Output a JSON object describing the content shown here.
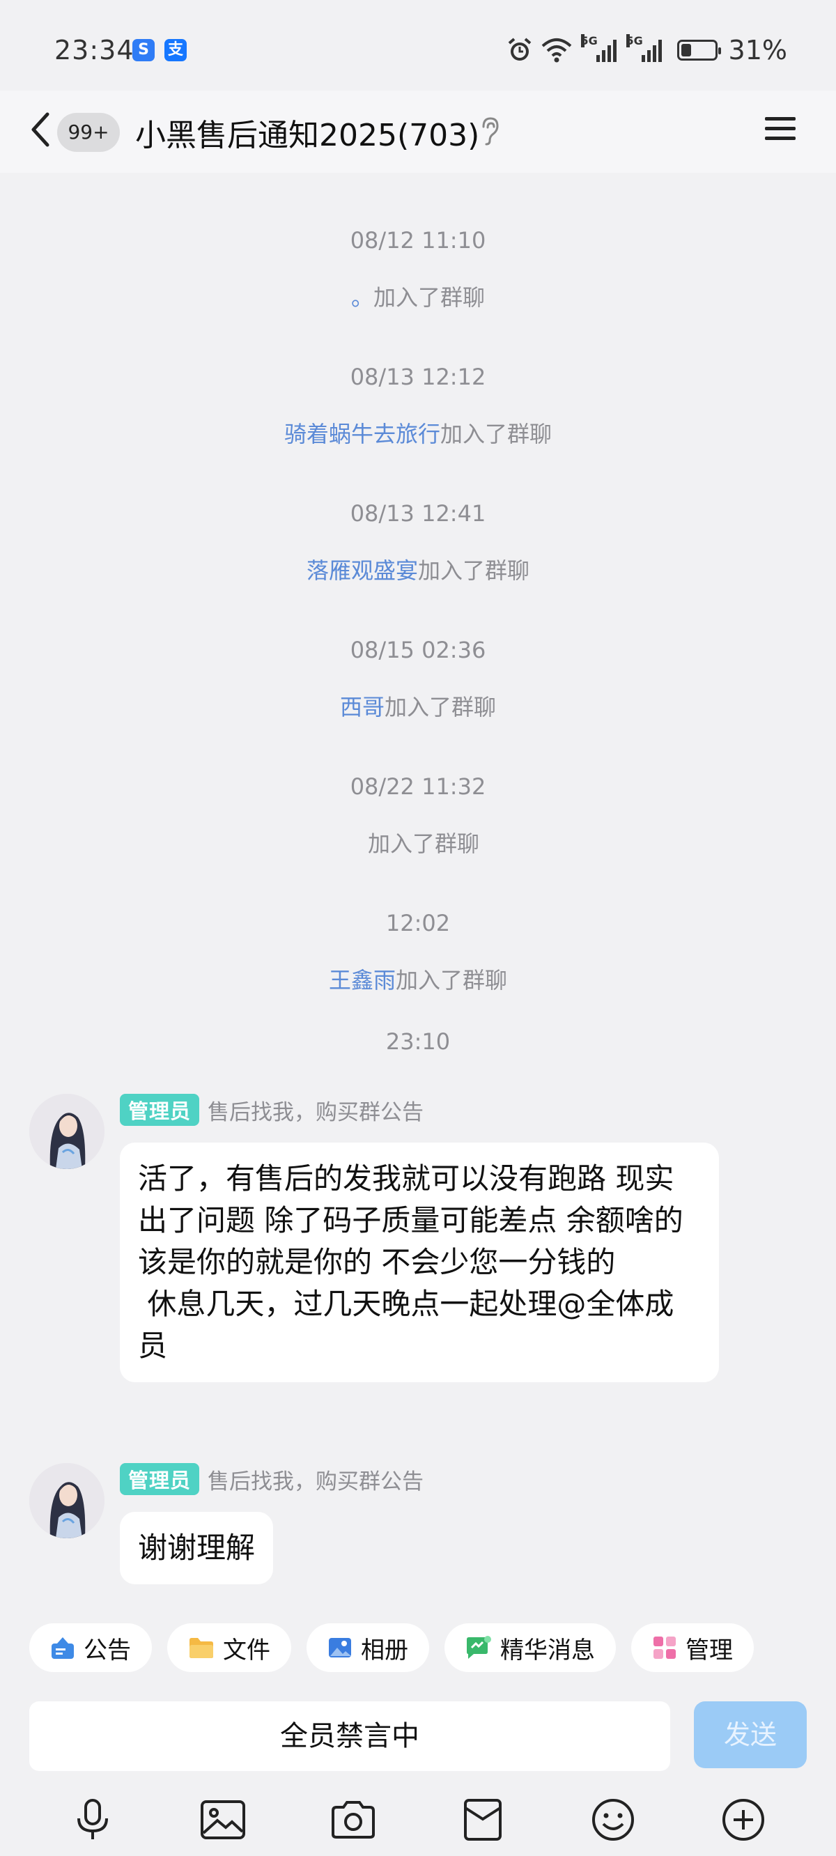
{
  "status_bar": {
    "time": "23:34",
    "app_icons": [
      "S",
      "支"
    ],
    "network": "5G",
    "battery_percent": "31%",
    "battery_level": 0.31
  },
  "header": {
    "unread_badge": "99+",
    "title": "小黑售后通知2025(703)",
    "icons": [
      "back-arrow-icon",
      "ear-icon",
      "menu-icon"
    ]
  },
  "system_events": [
    {
      "timestamp": "08/12 11:10",
      "name": "。",
      "action": "加入了群聊"
    },
    {
      "timestamp": "08/13 12:12",
      "name": "骑着蜗牛去旅行",
      "action": "加入了群聊"
    },
    {
      "timestamp": "08/13 12:41",
      "name": "落雁观盛宴",
      "action": "加入了群聊"
    },
    {
      "timestamp": "08/15 02:36",
      "name": "西哥",
      "action": "加入了群聊"
    },
    {
      "timestamp": "08/22 11:32",
      "name": "",
      "action": "加入了群聊"
    },
    {
      "timestamp": "12:02",
      "name": "王鑫雨",
      "action": "加入了群聊"
    }
  ],
  "last_timestamp": "23:10",
  "messages": [
    {
      "role": "管理员",
      "note": "售后找我，购买群公告",
      "text": "活了，有售后的发我就可以没有跑路 现实出了问题 除了码子质量可能差点 余额啥的 该是你的就是你的 不会少您一分钱的\n 休息几天，过几天晚点一起处理@全体成员"
    },
    {
      "role": "管理员",
      "note": "售后找我，购买群公告",
      "text": "谢谢理解"
    }
  ],
  "quick_actions": [
    {
      "label": "公告",
      "color": "#3e8ae6"
    },
    {
      "label": "文件",
      "color": "#f5b944"
    },
    {
      "label": "相册",
      "color": "#3a7de0"
    },
    {
      "label": "精华消息",
      "color": "#39b86b"
    },
    {
      "label": "管理",
      "color": "#ee6fa8"
    }
  ],
  "input": {
    "muted_text": "全员禁言中",
    "send_label": "发送"
  },
  "bottom_icons": [
    "microphone-icon",
    "image-icon",
    "camera-icon",
    "red-packet-icon",
    "emoji-icon",
    "plus-icon"
  ]
}
